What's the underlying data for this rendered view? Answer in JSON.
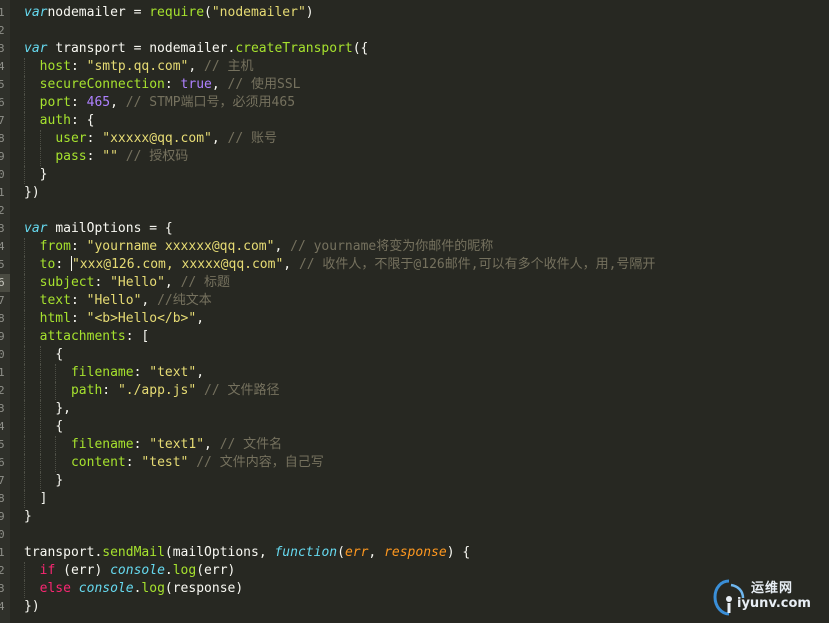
{
  "editor": {
    "active_line": 16,
    "lines": [
      {
        "n": "1",
        "indent": 0,
        "tokens": [
          [
            "kw",
            "var"
          ],
          [
            "",
            "nodemailer = "
          ],
          [
            "fn",
            "require"
          ],
          [
            "",
            "("
          ],
          [
            "str",
            "\"nodemailer\""
          ],
          [
            "",
            ")"
          ]
        ]
      },
      {
        "n": "2",
        "indent": 0,
        "tokens": []
      },
      {
        "n": "3",
        "indent": 0,
        "tokens": [
          [
            "kw",
            "var"
          ],
          [
            "",
            ""
          ],
          [
            "",
            "transport = nodemailer."
          ],
          [
            "fn",
            "createTransport"
          ],
          [
            "",
            "({"
          ]
        ]
      },
      {
        "n": "4",
        "indent": 1,
        "tokens": [
          [
            "prop",
            "host"
          ],
          [
            "",
            ": "
          ],
          [
            "str",
            "\"smtp.qq.com\""
          ],
          [
            "",
            ", "
          ],
          [
            "cm",
            "// 主机"
          ]
        ]
      },
      {
        "n": "5",
        "indent": 1,
        "tokens": [
          [
            "prop",
            "secureConnection"
          ],
          [
            "",
            ": "
          ],
          [
            "num",
            "true"
          ],
          [
            "",
            ", "
          ],
          [
            "cm",
            "// 使用SSL"
          ]
        ]
      },
      {
        "n": "6",
        "indent": 1,
        "tokens": [
          [
            "prop",
            "port"
          ],
          [
            "",
            ": "
          ],
          [
            "num",
            "465"
          ],
          [
            "",
            ", "
          ],
          [
            "cm",
            "// STMP端口号，必须用465"
          ]
        ]
      },
      {
        "n": "7",
        "indent": 1,
        "tokens": [
          [
            "prop",
            "auth"
          ],
          [
            "",
            ": {"
          ]
        ]
      },
      {
        "n": "8",
        "indent": 2,
        "tokens": [
          [
            "prop",
            "user"
          ],
          [
            "",
            ": "
          ],
          [
            "str",
            "\"xxxxx@qq.com\""
          ],
          [
            "",
            ", "
          ],
          [
            "cm",
            "// 账号"
          ]
        ]
      },
      {
        "n": "9",
        "indent": 2,
        "tokens": [
          [
            "prop",
            "pass"
          ],
          [
            "",
            ": "
          ],
          [
            "str",
            "\"\""
          ],
          [
            "cm",
            " // 授权码"
          ]
        ]
      },
      {
        "n": "0",
        "indent": 1,
        "tokens": [
          [
            "",
            "}"
          ]
        ]
      },
      {
        "n": "1",
        "indent": 0,
        "tokens": [
          [
            "",
            "})"
          ]
        ]
      },
      {
        "n": "2",
        "indent": 0,
        "tokens": []
      },
      {
        "n": "3",
        "indent": 0,
        "tokens": [
          [
            "kw",
            "var"
          ],
          [
            "",
            ""
          ],
          [
            "",
            "mailOptions = {"
          ]
        ]
      },
      {
        "n": "4",
        "indent": 1,
        "tokens": [
          [
            "prop",
            "from"
          ],
          [
            "",
            ": "
          ],
          [
            "str",
            "\"yourname xxxxxx@qq.com\""
          ],
          [
            "",
            ", "
          ],
          [
            "cm",
            "// yourname将变为你邮件的昵称"
          ]
        ]
      },
      {
        "n": "5",
        "indent": 1,
        "cursor_after": 1,
        "tokens": [
          [
            "prop",
            "to"
          ],
          [
            "",
            ": "
          ],
          [
            "str",
            "\"xxx@126.com, xxxxx@qq.com"
          ],
          [
            "str",
            "\""
          ],
          [
            "",
            ", "
          ],
          [
            "cm",
            "// 收件人，不限于@126邮件,可以有多个收件人，用,号隔开"
          ]
        ]
      },
      {
        "n": "6",
        "indent": 1,
        "tokens": [
          [
            "prop",
            "subject"
          ],
          [
            "",
            ": "
          ],
          [
            "str",
            "\"Hello\""
          ],
          [
            "",
            ", "
          ],
          [
            "cm",
            "// 标题"
          ]
        ]
      },
      {
        "n": "7",
        "indent": 1,
        "tokens": [
          [
            "prop",
            "text"
          ],
          [
            "",
            ": "
          ],
          [
            "str",
            "\"Hello\""
          ],
          [
            "",
            ", "
          ],
          [
            "cm",
            "//纯文本"
          ]
        ]
      },
      {
        "n": "8",
        "indent": 1,
        "tokens": [
          [
            "prop",
            "html"
          ],
          [
            "",
            ": "
          ],
          [
            "str",
            "\"<b>Hello</b>\""
          ],
          [
            "",
            ","
          ]
        ]
      },
      {
        "n": "9",
        "indent": 1,
        "tokens": [
          [
            "prop",
            "attachments"
          ],
          [
            "",
            ": ["
          ]
        ]
      },
      {
        "n": "0",
        "indent": 2,
        "tokens": [
          [
            "",
            "{"
          ]
        ]
      },
      {
        "n": "1",
        "indent": 3,
        "tokens": [
          [
            "prop",
            "filename"
          ],
          [
            "",
            ": "
          ],
          [
            "str",
            "\"text\""
          ],
          [
            "",
            ","
          ]
        ]
      },
      {
        "n": "2",
        "indent": 3,
        "tokens": [
          [
            "prop",
            "path"
          ],
          [
            "",
            ": "
          ],
          [
            "str",
            "\"./app.js\""
          ],
          [
            "cm",
            " // 文件路径"
          ]
        ]
      },
      {
        "n": "3",
        "indent": 2,
        "tokens": [
          [
            "",
            "},"
          ]
        ]
      },
      {
        "n": "4",
        "indent": 2,
        "tokens": [
          [
            "",
            "{"
          ]
        ]
      },
      {
        "n": "5",
        "indent": 3,
        "tokens": [
          [
            "prop",
            "filename"
          ],
          [
            "",
            ": "
          ],
          [
            "str",
            "\"text1\""
          ],
          [
            "",
            ", "
          ],
          [
            "cm",
            "// 文件名"
          ]
        ]
      },
      {
        "n": "6",
        "indent": 3,
        "tokens": [
          [
            "prop",
            "content"
          ],
          [
            "",
            ": "
          ],
          [
            "str",
            "\"test\""
          ],
          [
            "cm",
            " // 文件内容，自己写"
          ]
        ]
      },
      {
        "n": "7",
        "indent": 2,
        "tokens": [
          [
            "",
            "}"
          ]
        ]
      },
      {
        "n": "8",
        "indent": 1,
        "tokens": [
          [
            "",
            "]"
          ]
        ]
      },
      {
        "n": "9",
        "indent": 0,
        "tokens": [
          [
            "",
            "}"
          ]
        ]
      },
      {
        "n": "0",
        "indent": 0,
        "tokens": []
      },
      {
        "n": "1",
        "indent": 0,
        "tokens": [
          [
            "",
            "transport."
          ],
          [
            "fn",
            "sendMail"
          ],
          [
            "",
            "(mailOptions, "
          ],
          [
            "kw",
            "function"
          ],
          [
            "",
            "("
          ],
          [
            "param",
            "err"
          ],
          [
            "",
            ", "
          ],
          [
            "param",
            "response"
          ],
          [
            "",
            ") {"
          ]
        ]
      },
      {
        "n": "2",
        "indent": 1,
        "tokens": [
          [
            "kw2",
            "if"
          ],
          [
            "",
            ""
          ],
          [
            "",
            "(err) "
          ],
          [
            "kw",
            "console"
          ],
          [
            "",
            "."
          ],
          [
            "fn",
            "log"
          ],
          [
            "",
            "(err)"
          ]
        ]
      },
      {
        "n": "3",
        "indent": 1,
        "tokens": [
          [
            "kw2",
            "else"
          ],
          [
            "",
            ""
          ],
          [
            "kw",
            "console"
          ],
          [
            "",
            "."
          ],
          [
            "fn",
            "log"
          ],
          [
            "",
            "(response)"
          ]
        ]
      },
      {
        "n": "4",
        "indent": 0,
        "tokens": [
          [
            "",
            "})"
          ]
        ]
      }
    ]
  },
  "watermark": {
    "title": "运维网",
    "url": "iyunv.com"
  },
  "colors": {
    "background": "#272822",
    "keyword": "#66d9ef",
    "string": "#e6db74",
    "comment": "#75715e",
    "function": "#a6e22e"
  }
}
